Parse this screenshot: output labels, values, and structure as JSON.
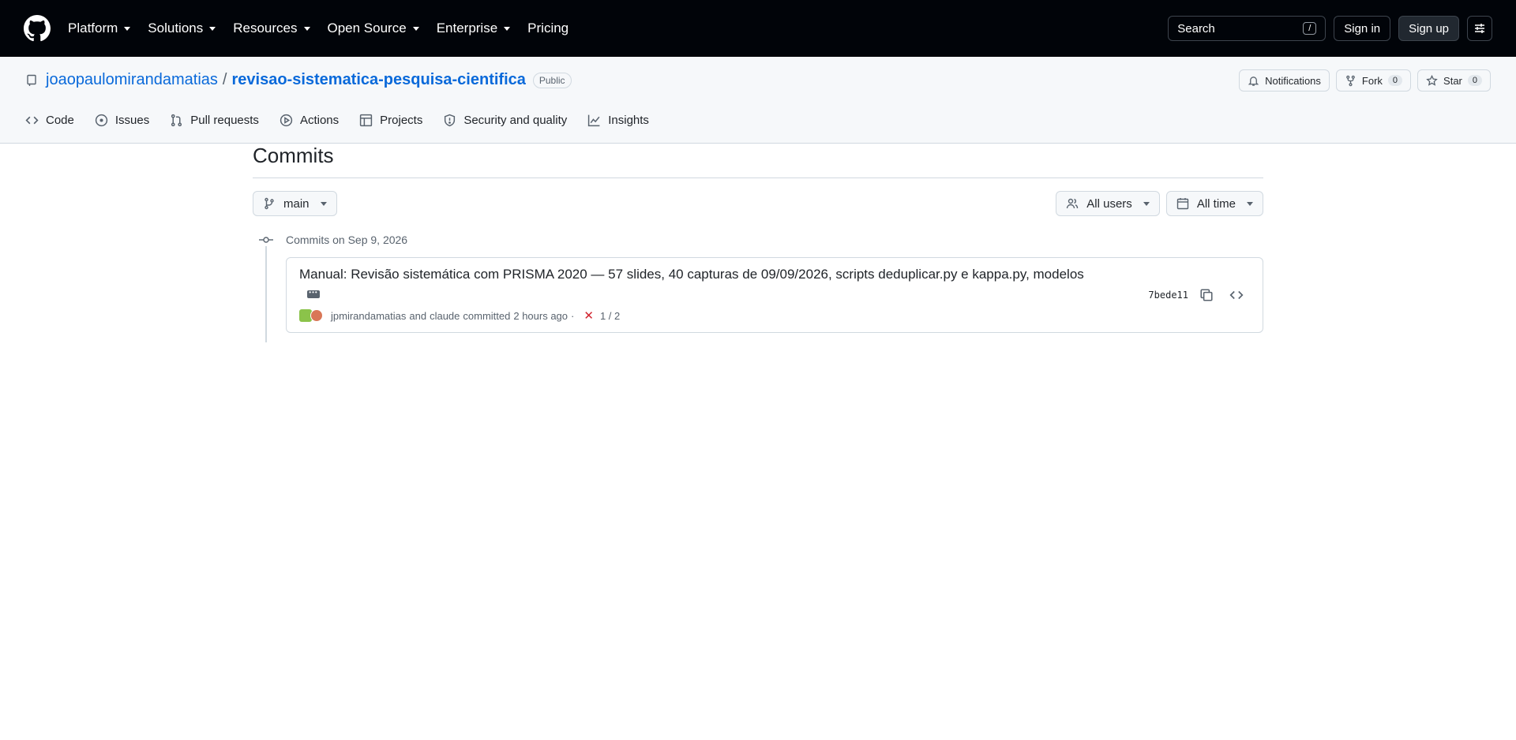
{
  "header": {
    "nav": [
      {
        "label": "Platform",
        "has_caret": true
      },
      {
        "label": "Solutions",
        "has_caret": true
      },
      {
        "label": "Resources",
        "has_caret": true
      },
      {
        "label": "Open Source",
        "has_caret": true
      },
      {
        "label": "Enterprise",
        "has_caret": true
      },
      {
        "label": "Pricing",
        "has_caret": false
      }
    ],
    "search_label": "Search",
    "search_shortcut": "/",
    "sign_in": "Sign in",
    "sign_up": "Sign up"
  },
  "repo": {
    "owner": "joaopaulomirandamatias",
    "separator": "/",
    "name": "revisao-sistematica-pesquisa-cientifica",
    "visibility": "Public",
    "notifications_label": "Notifications",
    "fork_label": "Fork",
    "fork_count": "0",
    "star_label": "Star",
    "star_count": "0"
  },
  "tabs": [
    {
      "label": "Code",
      "icon": "code-icon"
    },
    {
      "label": "Issues",
      "icon": "issue-icon"
    },
    {
      "label": "Pull requests",
      "icon": "pull-request-icon"
    },
    {
      "label": "Actions",
      "icon": "play-icon"
    },
    {
      "label": "Projects",
      "icon": "table-icon"
    },
    {
      "label": "Security and quality",
      "icon": "shield-icon"
    },
    {
      "label": "Insights",
      "icon": "graph-icon"
    }
  ],
  "page": {
    "title": "Commits",
    "branch": "main",
    "users_filter": "All users",
    "time_filter": "All time"
  },
  "commit_group": {
    "heading": "Commits on Sep 9, 2026",
    "commits": [
      {
        "message": "Manual: Revisão sistemática com PRISMA 2020 — 57 slides, 40 capturas de 09/09/2026, scripts deduplicar.py e kappa.py, modelos",
        "author1": "jpmirandamatias",
        "and": "and",
        "author2": "claude",
        "committed": "committed",
        "time": "2 hours ago",
        "dot": "·",
        "status_icon": "x-icon",
        "checks": "1 / 2",
        "sha": "7bede11"
      }
    ]
  },
  "colors": {
    "header_bg": "#010409",
    "link": "#0969da",
    "fail": "#d1242f"
  }
}
